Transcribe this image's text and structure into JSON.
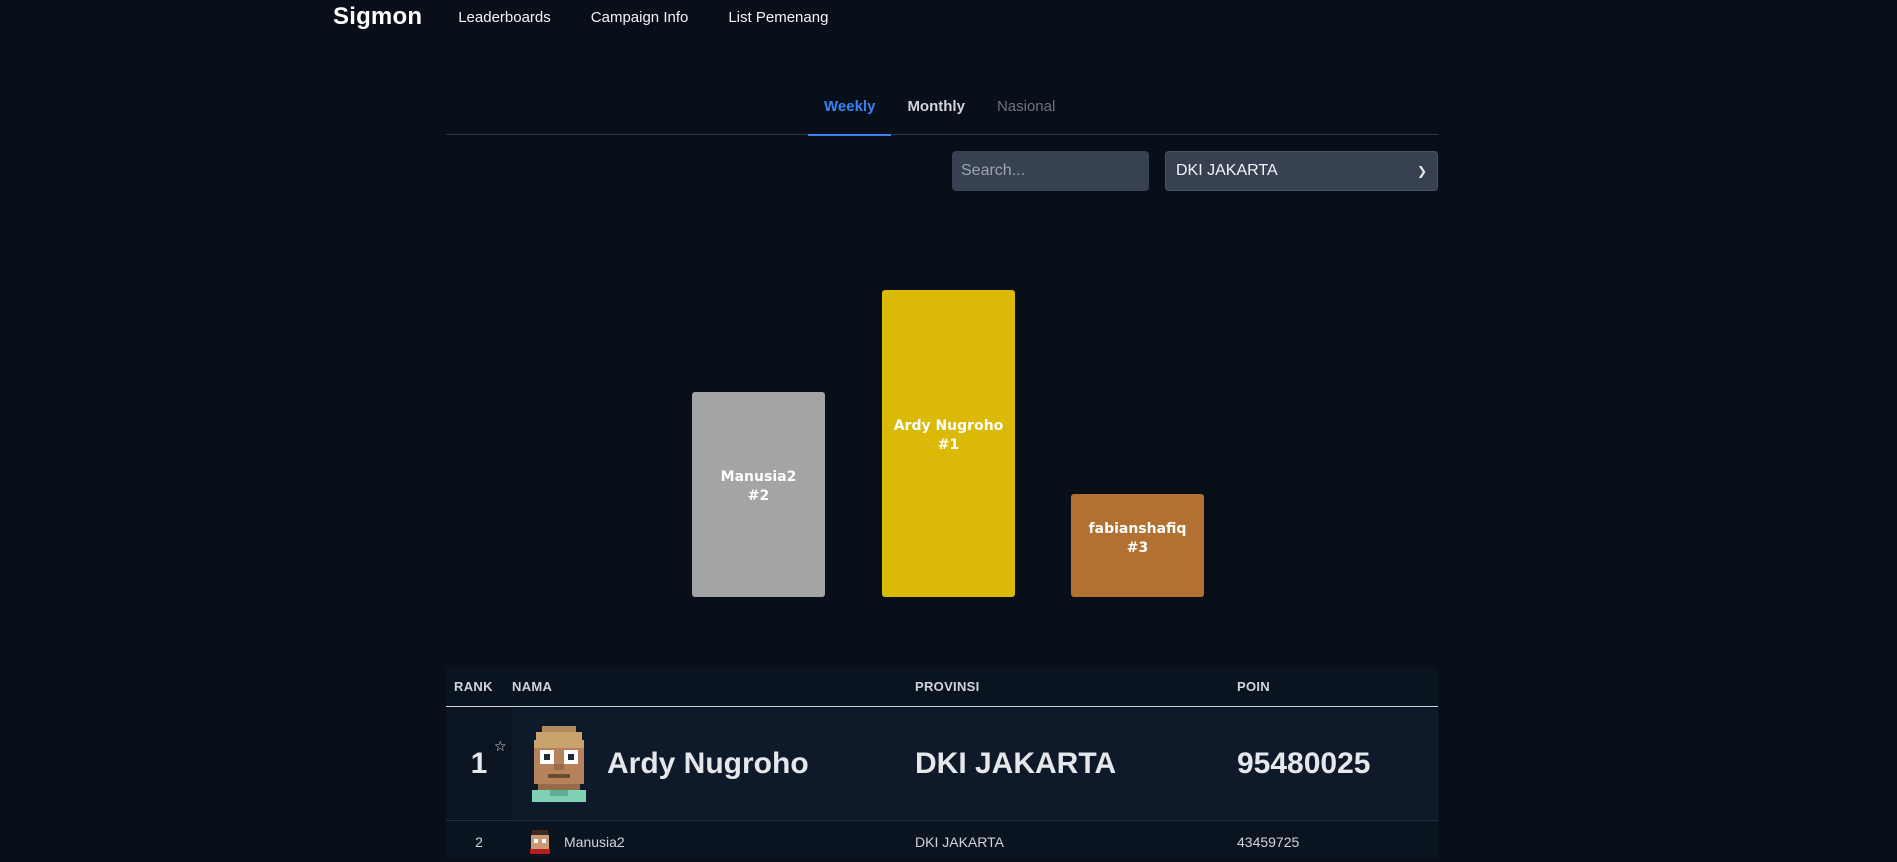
{
  "nav": {
    "brand": "Sigmon",
    "links": [
      "Leaderboards",
      "Campaign Info",
      "List Pemenang"
    ]
  },
  "tabs": [
    {
      "label": "Weekly",
      "state": "active"
    },
    {
      "label": "Monthly",
      "state": "normal"
    },
    {
      "label": "Nasional",
      "state": "muted"
    }
  ],
  "filters": {
    "search_placeholder": "Search...",
    "province_selected": "DKI JAKARTA"
  },
  "podium": {
    "first": {
      "name": "Ardy Nugroho",
      "rank": "#1",
      "color": "#dab907"
    },
    "second": {
      "name": "Manusia2",
      "rank": "#2",
      "color": "#a3a4a6"
    },
    "third": {
      "name": "fabianshafiq",
      "rank": "#3",
      "color": "#b27032"
    }
  },
  "table": {
    "headers": {
      "rank": "RANK",
      "nama": "NAMA",
      "provinsi": "PROVINSI",
      "poin": "POIN"
    },
    "rows": [
      {
        "rank": "1",
        "name": "Ardy Nugroho",
        "province": "DKI JAKARTA",
        "points": "95480025"
      },
      {
        "rank": "2",
        "name": "Manusia2",
        "province": "DKI JAKARTA",
        "points": "43459725"
      }
    ]
  },
  "colors": {
    "accent": "#3b82f6",
    "background": "#080f18"
  }
}
